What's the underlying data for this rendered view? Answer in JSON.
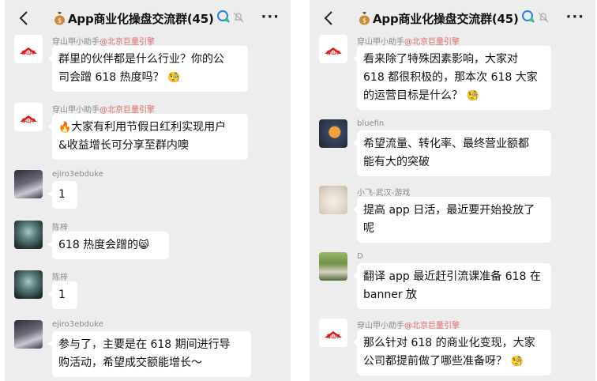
{
  "left_panel": {
    "title": "App商业化操盘交流群(45)",
    "messages": [
      {
        "sender": "穿山甲小助手",
        "org": "@北京巨量引擎",
        "line1": "群里的伙伴都是什么行业？你的公",
        "line2": "司会蹭 618 热度吗？",
        "emoji": "🧐"
      },
      {
        "sender": "穿山甲小助手",
        "org": "@北京巨量引擎",
        "line1": "大家有利用节假日红利实现用户",
        "line2": "&收益增长可分享至群内噢",
        "emoji": "🔥"
      },
      {
        "sender": "ejiro3ebduke",
        "text": "1"
      },
      {
        "sender": "陈梓",
        "text": "618 热度会蹭的",
        "emoji": "😸"
      },
      {
        "sender": "陈梓",
        "text": "1"
      },
      {
        "sender": "ejiro3ebduke",
        "line1": "参与了，主要是在 618 期间进行导",
        "line2": "购活动，希望成交额能增长～"
      }
    ]
  },
  "right_panel": {
    "title": "App商业化操盘交流群(45)",
    "messages": [
      {
        "sender": "穿山甲小助手",
        "org": "@北京巨量引擎",
        "line1": "看来除了特殊因素影响，大家对",
        "line2": "618 都很积极的，那本次 618 大家",
        "line3": "的运营目标是什么？",
        "emoji": "🧐"
      },
      {
        "sender": "bluefin",
        "line1": "希望流量、转化率、最终营业额都",
        "line2": "能有大的突破"
      },
      {
        "sender": "小飞-武汉-游戏",
        "line1": "提高 app 日活，最近要开始投放了",
        "line2": "呢"
      },
      {
        "sender": "D",
        "line1": "翻译 app 最近赶引流课准备 618 在",
        "line2": "banner 放"
      },
      {
        "sender": "穿山甲小助手",
        "org": "@北京巨量引擎",
        "line1": "那么针对 618 的商业化变现，大家",
        "line2": "公司都提前做了哪些准备呀？",
        "emoji": "🧐"
      }
    ]
  },
  "logo_text": "穿山甲",
  "more_label": "···",
  "colors": {
    "org_red": "#e06767",
    "brand_red": "#d21c1c",
    "chat_bg": "#ededed",
    "bubble": "#ffffff"
  }
}
